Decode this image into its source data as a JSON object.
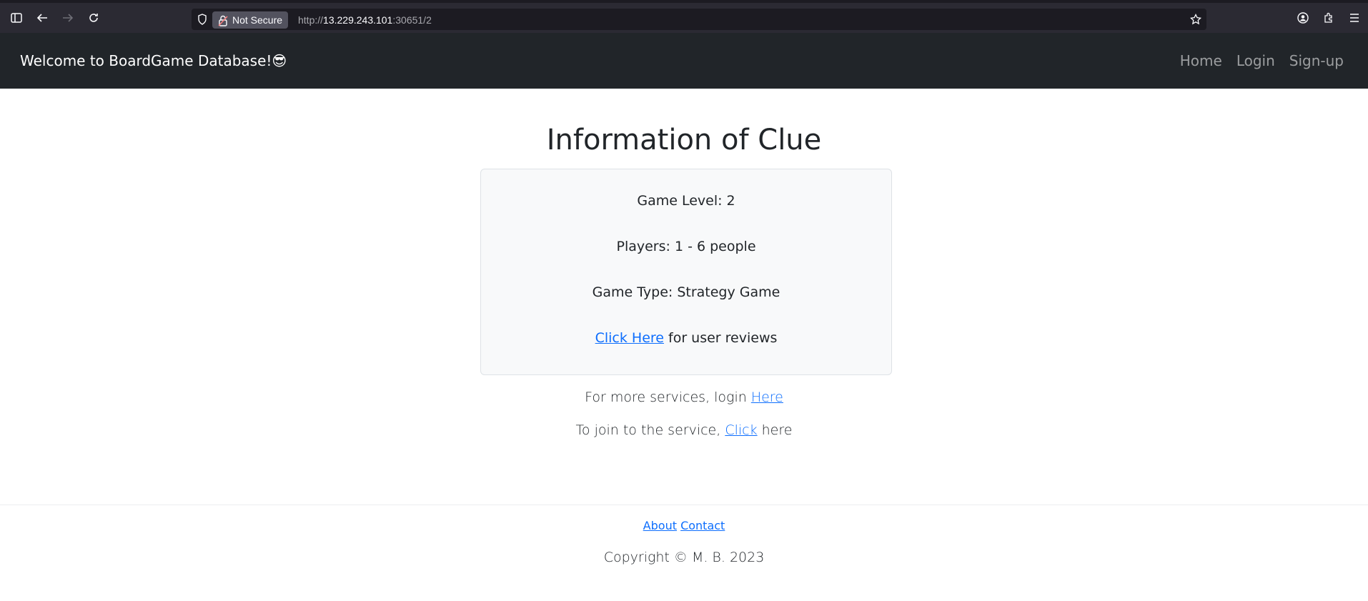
{
  "browser": {
    "security_label": "Not Secure",
    "url_scheme": "http://",
    "url_host": "13.229.243.101",
    "url_path": ":30651/2"
  },
  "navbar": {
    "brand": "Welcome to BoardGame Database!😎",
    "links": [
      "Home",
      "Login",
      "Sign-up"
    ]
  },
  "main": {
    "title": "Information of Clue",
    "game_level": "Game Level: 2",
    "players": "Players: 1 - 6 people",
    "game_type": "Game Type: Strategy Game",
    "reviews_link": "Click Here",
    "reviews_text": " for user reviews",
    "login_prefix": "For more services, login ",
    "login_link": "Here",
    "join_prefix": "To join to the service, ",
    "join_link": "Click",
    "join_suffix": " here"
  },
  "footer": {
    "about": "About",
    "contact": "Contact",
    "copyright": "Copyright © M. B. 2023"
  },
  "colors": {
    "navbar_bg": "#212529",
    "link": "#0d6efd",
    "card_bg": "#f8f9fa"
  }
}
